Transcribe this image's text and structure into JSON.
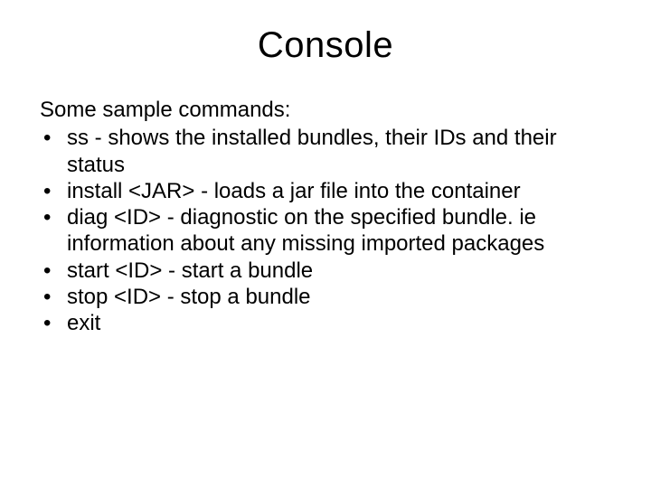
{
  "slide": {
    "title": "Console",
    "intro": "Some sample commands:",
    "bullets": [
      "ss - shows the installed bundles, their IDs and their status",
      "install <JAR> - loads a jar file into the container",
      "diag <ID> - diagnostic on the specified bundle. ie information about any missing imported packages",
      "start <ID> - start a bundle",
      "stop <ID> - stop a bundle",
      "exit"
    ]
  }
}
